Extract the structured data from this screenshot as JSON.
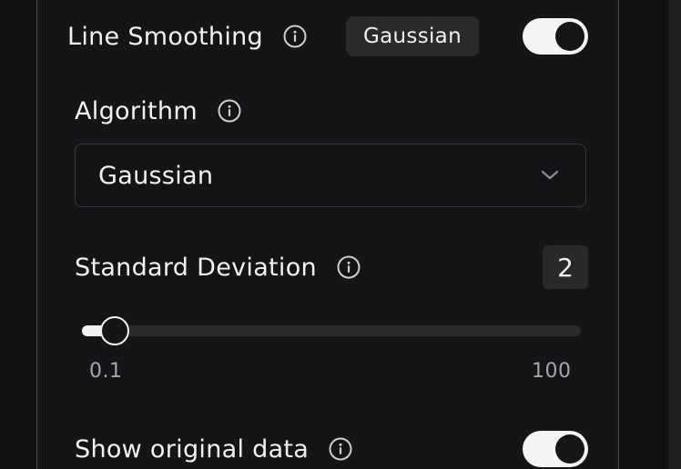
{
  "line_smoothing": {
    "title": "Line Smoothing",
    "badge": "Gaussian",
    "enabled": true
  },
  "algorithm": {
    "label": "Algorithm",
    "selected": "Gaussian"
  },
  "standard_deviation": {
    "label": "Standard Deviation",
    "value": "2",
    "min_label": "0.1",
    "max_label": "100",
    "min": 0.1,
    "max": 100,
    "current": 2
  },
  "show_original": {
    "label": "Show original data",
    "enabled": true
  },
  "icons": {
    "info": "info-icon",
    "dropdown": "chevron-down-icon"
  },
  "colors": {
    "background": "#121214",
    "panel": "#151517",
    "toggle_on": "#f4f4f4",
    "knob": "#161618",
    "muted_text": "#a6a6aa"
  }
}
